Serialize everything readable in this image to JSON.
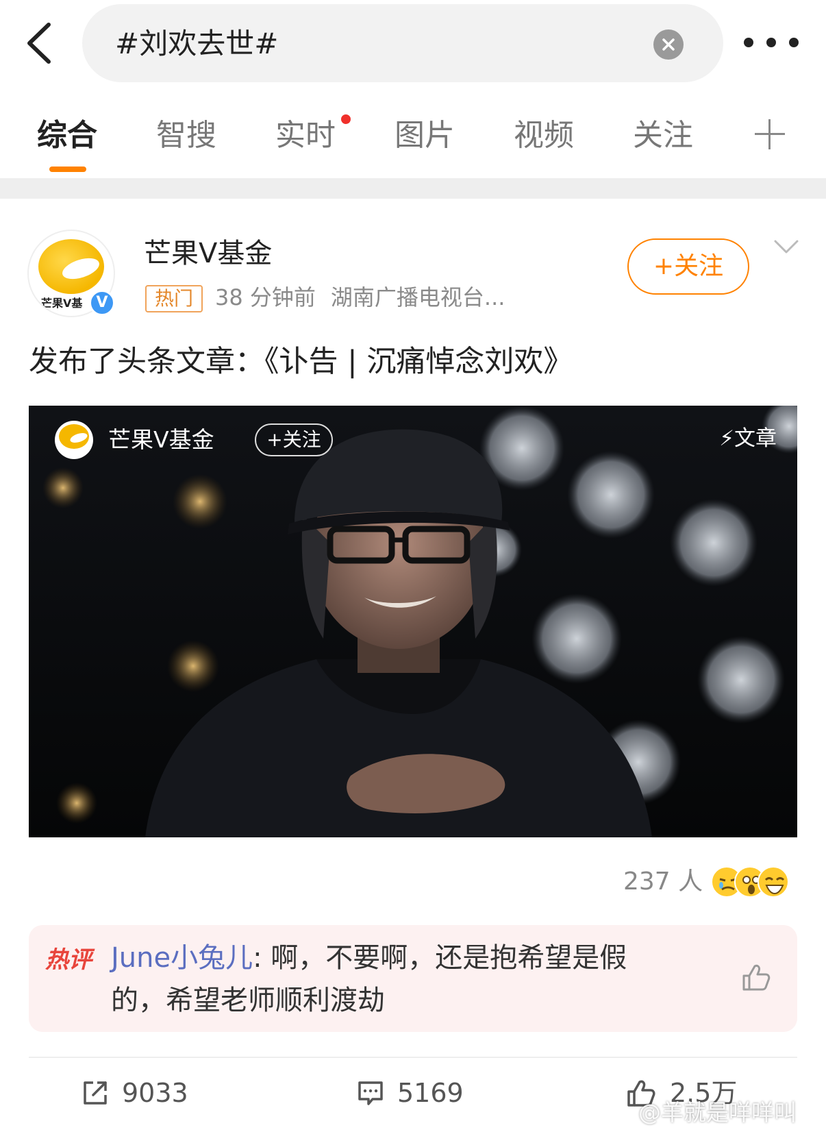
{
  "search": {
    "query": "#刘欢去世#"
  },
  "tabs": [
    {
      "label": "综合"
    },
    {
      "label": "智搜"
    },
    {
      "label": "实时"
    },
    {
      "label": "图片"
    },
    {
      "label": "视频"
    },
    {
      "label": "关注"
    }
  ],
  "colors": {
    "accent": "#ff8200",
    "hot_red": "#e8453c",
    "link_blue": "#5b6ec0",
    "verified_blue": "#3d98f5"
  },
  "post": {
    "username": "芒果V基金",
    "avatar_text": "芒果V基",
    "verified_mark": "V",
    "hot_tag": "热门",
    "time": "38 分钟前",
    "source": "湖南广播电视台...",
    "follow_label": "+关注",
    "text": "发布了头条文章：《讣告 | 沉痛悼念刘欢》"
  },
  "article_card": {
    "account_name": "芒果V基金",
    "follow_label": "+关注",
    "type_label": "⚡文章"
  },
  "reactions": {
    "count_text": "237 人"
  },
  "hot_comment": {
    "label": "热评",
    "author": "June小兔儿",
    "text_line1": ": 啊，不要啊，还是抱希望是假",
    "text_line2": "的，希望老师顺利渡劫"
  },
  "actions": {
    "repost": "9033",
    "comment": "5169",
    "like": "2.5万"
  },
  "watermark": "@羊就是咩咩叫"
}
